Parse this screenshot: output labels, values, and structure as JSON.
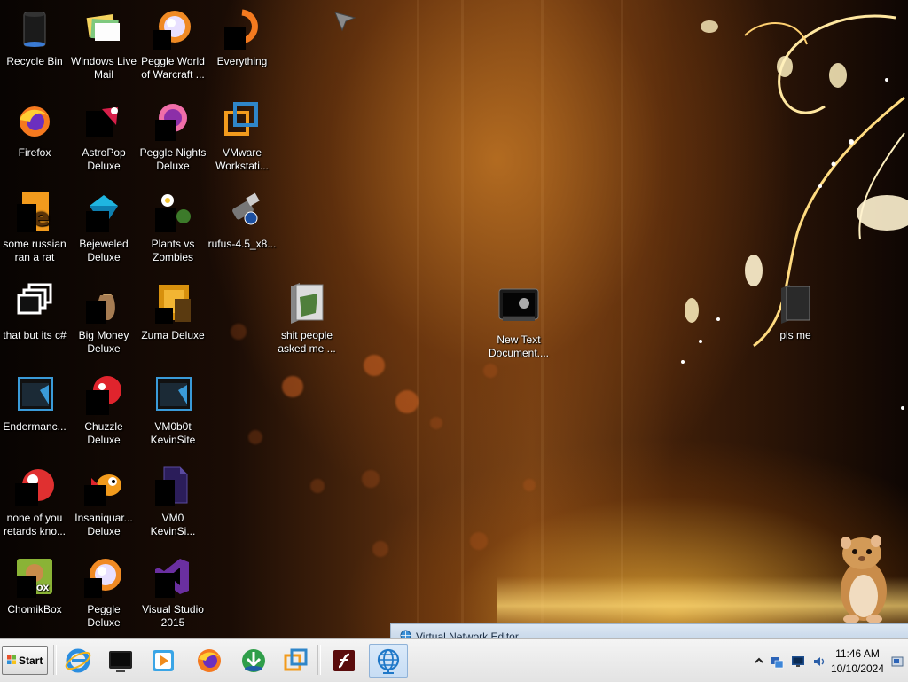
{
  "desktop": {
    "icons": [
      {
        "name": "recycle-bin",
        "label": "Recycle Bin",
        "icon": "recycle-bin-icon"
      },
      {
        "name": "windows-live-mail",
        "label": "Windows Live Mail",
        "icon": "mail-envelopes-icon"
      },
      {
        "name": "peggle-world-of-warcraft",
        "label": "Peggle World of Warcraft ...",
        "icon": "peggle-ball-icon"
      },
      {
        "name": "everything",
        "label": "Everything",
        "icon": "everything-search-icon"
      },
      {
        "name": "firefox",
        "label": "Firefox",
        "icon": "firefox-icon"
      },
      {
        "name": "astropop-deluxe",
        "label": "AstroPop Deluxe",
        "icon": "astropop-icon"
      },
      {
        "name": "peggle-nights-deluxe",
        "label": "Peggle Nights Deluxe",
        "icon": "peggle-nights-icon"
      },
      {
        "name": "vmware-workstation",
        "label": "VMware Workstati...",
        "icon": "vmware-icon"
      },
      {
        "name": "some-russian-ran-a-rat",
        "label": "some russian ran a rat",
        "icon": "file-e-icon"
      },
      {
        "name": "bejeweled-deluxe",
        "label": "Bejeweled Deluxe",
        "icon": "bejeweled-gem-icon"
      },
      {
        "name": "plants-vs-zombies",
        "label": "Plants vs Zombies",
        "icon": "plants-vs-zombies-icon"
      },
      {
        "name": "rufus",
        "label": "rufus-4.5_x8...",
        "icon": "usb-drive-icon"
      },
      {
        "name": "that-but-its-csharp",
        "label": "that but its c#",
        "icon": "stacked-windows-icon"
      },
      {
        "name": "big-money-deluxe",
        "label": "Big Money Deluxe",
        "icon": "money-bag-icon"
      },
      {
        "name": "zuma-deluxe",
        "label": "Zuma Deluxe",
        "icon": "zuma-icon"
      },
      {
        "name": "shit-people-asked-me",
        "label": "shit people asked me ...",
        "icon": "folder-icon"
      },
      {
        "name": "new-text-document",
        "label": "New Text Document....",
        "icon": "console-monitor-icon"
      },
      {
        "name": "pls-me",
        "label": "pls me",
        "icon": "dark-folder-icon"
      },
      {
        "name": "endermanch",
        "label": "Endermanc...",
        "icon": "dark-window-icon"
      },
      {
        "name": "chuzzle-deluxe",
        "label": "Chuzzle Deluxe",
        "icon": "chuzzle-icon"
      },
      {
        "name": "vm0b0t-kevinsite",
        "label": "VM0b0t KevinSite",
        "icon": "dark-window-icon"
      },
      {
        "name": "none-of-you",
        "label": "none of you retards kno...",
        "icon": "red-ball-icon"
      },
      {
        "name": "insaniquarium-deluxe",
        "label": "Insaniquar... Deluxe",
        "icon": "goldfish-icon"
      },
      {
        "name": "vm0-kevinsite",
        "label": "VM0 KevinSi...",
        "icon": "file-document-icon"
      },
      {
        "name": "chomikbox",
        "label": "ChomikBox",
        "icon": "chomikbox-icon"
      },
      {
        "name": "peggle-deluxe",
        "label": "Peggle Deluxe",
        "icon": "peggle-ball-icon"
      },
      {
        "name": "visual-studio-2015",
        "label": "Visual Studio 2015",
        "icon": "visual-studio-icon"
      }
    ]
  },
  "window_strip": {
    "title": "Virtual Network Editor"
  },
  "taskbar": {
    "start_label": "Start",
    "pinned": [
      {
        "name": "internet-explorer",
        "icon": "internet-explorer-icon"
      },
      {
        "name": "console",
        "icon": "console-monitor-icon"
      },
      {
        "name": "media-player",
        "icon": "media-player-icon"
      },
      {
        "name": "firefox",
        "icon": "firefox-icon"
      },
      {
        "name": "download-manager",
        "icon": "download-manager-icon"
      },
      {
        "name": "vmware",
        "icon": "vmware-icon"
      },
      {
        "name": "flash",
        "icon": "flash-icon"
      },
      {
        "name": "virtual-network-editor",
        "icon": "globe-network-icon"
      }
    ],
    "clock": {
      "time": "11:46 AM",
      "date": "10/10/2024"
    }
  },
  "colors": {
    "taskbar_bg": "#ececec",
    "accent_orange": "#f39a1e",
    "wallpaper_dark": "#1a0c05"
  }
}
